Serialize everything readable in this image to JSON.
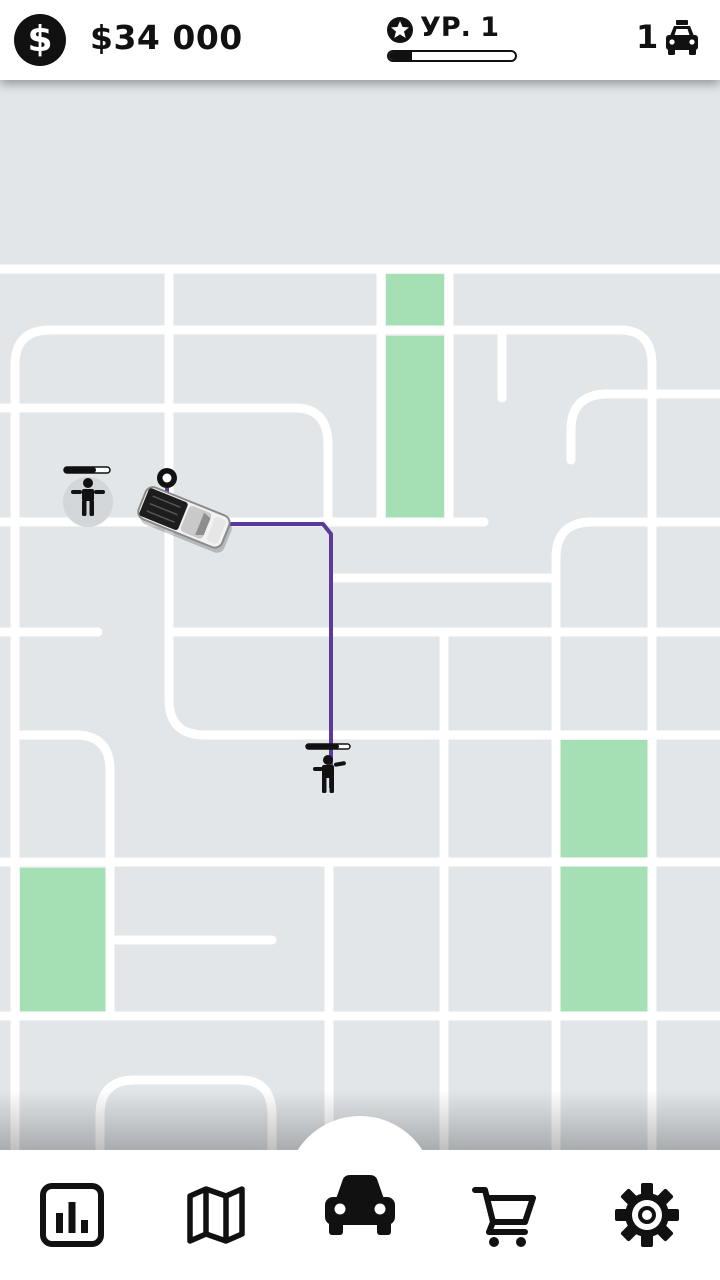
{
  "header": {
    "currency_icon": "dollar-icon",
    "currency_symbol": "$",
    "money": "$34 000",
    "level_icon": "star-badge-icon",
    "level_label": "УР. 1",
    "xp_progress": 0.18,
    "car_count": "1",
    "car_icon": "taxi-icon"
  },
  "map": {
    "background_color": "#e2e6e9",
    "road_color": "#ffffff",
    "park_color": "#a5e0b5",
    "route_color": "#5b3a9e",
    "passengers": [
      {
        "name": "waiting-passenger",
        "patience": 0.7
      },
      {
        "name": "destination-passenger",
        "patience": 0.75
      }
    ],
    "vehicle": {
      "icon": "pickup-truck-icon",
      "pin_icon": "location-pin-icon"
    }
  },
  "navbar": {
    "items": [
      {
        "icon": "bar-chart-icon",
        "active": false
      },
      {
        "icon": "map-icon",
        "active": false
      },
      {
        "icon": "car-icon",
        "active": true
      },
      {
        "icon": "shopping-cart-icon",
        "active": false
      },
      {
        "icon": "gear-icon",
        "active": false
      }
    ]
  }
}
